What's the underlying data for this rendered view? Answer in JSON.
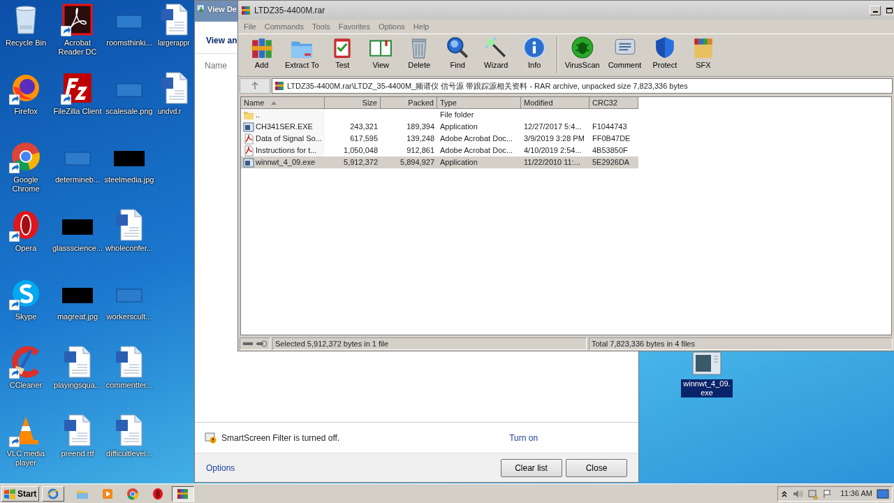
{
  "desktop": {
    "icons": [
      {
        "label": "Recycle Bin",
        "kind": "recycle-bin",
        "shortcut": false
      },
      {
        "label": "Firefox",
        "kind": "firefox",
        "shortcut": true
      },
      {
        "label": "Google Chrome",
        "kind": "chrome",
        "shortcut": true
      },
      {
        "label": "Opera",
        "kind": "opera",
        "shortcut": true
      },
      {
        "label": "Skype",
        "kind": "skype",
        "shortcut": true
      },
      {
        "label": "CCleaner",
        "kind": "ccleaner",
        "shortcut": true
      },
      {
        "label": "VLC media player",
        "kind": "vlc",
        "shortcut": true
      },
      {
        "label": "Acrobat Reader DC",
        "kind": "acrobat",
        "shortcut": true
      },
      {
        "label": "FileZilla Client",
        "kind": "filezilla",
        "shortcut": true
      },
      {
        "label": "determineb...",
        "kind": "blank",
        "shortcut": false
      },
      {
        "label": "glassscience...",
        "kind": "black",
        "shortcut": false
      },
      {
        "label": "magreat.jpg",
        "kind": "black",
        "shortcut": false
      },
      {
        "label": "playingsqua...",
        "kind": "word",
        "shortcut": false
      },
      {
        "label": "preend.rtf",
        "kind": "word",
        "shortcut": false
      },
      {
        "label": "roomsthinki...",
        "kind": "blank",
        "shortcut": false
      },
      {
        "label": "scalesale.png",
        "kind": "blank",
        "shortcut": false
      },
      {
        "label": "steelmedia.jpg",
        "kind": "black",
        "shortcut": false
      },
      {
        "label": "wholeconfer...",
        "kind": "word",
        "shortcut": false
      },
      {
        "label": "workerscult...",
        "kind": "blank",
        "shortcut": false
      },
      {
        "label": "commentter...",
        "kind": "word",
        "shortcut": false
      },
      {
        "label": "difficultlevel...",
        "kind": "word",
        "shortcut": false
      },
      {
        "label": "largerappr",
        "kind": "word",
        "shortcut": false
      },
      {
        "label": "undvd.r",
        "kind": "word",
        "shortcut": false
      }
    ]
  },
  "downloads_window": {
    "title": "View De",
    "heading": "View an",
    "column": "Name",
    "smartscreen": {
      "text": "SmartScreen Filter is turned off.",
      "link": "Turn on"
    },
    "options_link": "Options",
    "buttons": [
      "Clear list",
      "Close"
    ]
  },
  "winrar": {
    "title": "LTDZ35-4400M.rar",
    "menu": [
      "File",
      "Commands",
      "Tools",
      "Favorites",
      "Options",
      "Help"
    ],
    "toolbar_groups": [
      [
        {
          "label": "Add",
          "kind": "add"
        },
        {
          "label": "Extract To",
          "kind": "extract"
        },
        {
          "label": "Test",
          "kind": "test"
        },
        {
          "label": "View",
          "kind": "view"
        },
        {
          "label": "Delete",
          "kind": "delete"
        },
        {
          "label": "Find",
          "kind": "find"
        },
        {
          "label": "Wizard",
          "kind": "wizard"
        },
        {
          "label": "Info",
          "kind": "info"
        }
      ],
      [
        {
          "label": "VirusScan",
          "kind": "virus"
        },
        {
          "label": "Comment",
          "kind": "comment"
        },
        {
          "label": "Protect",
          "kind": "protect"
        },
        {
          "label": "SFX",
          "kind": "sfx"
        }
      ]
    ],
    "address": "LTDZ35-4400M.rar\\LTDZ_35-4400M_频谱仪 信号源 带跟踪源相关资料 - RAR archive, unpacked size 7,823,336 bytes",
    "columns": [
      {
        "label": "Name",
        "sorted": true
      },
      {
        "label": "Size",
        "sorted": false
      },
      {
        "label": "Packed",
        "sorted": false
      },
      {
        "label": "Type",
        "sorted": false
      },
      {
        "label": "Modified",
        "sorted": false
      },
      {
        "label": "CRC32",
        "sorted": false
      }
    ],
    "rows": [
      {
        "kind": "folder",
        "selected": false,
        "cells": [
          "..",
          "",
          "",
          "File folder",
          "",
          ""
        ]
      },
      {
        "kind": "exe",
        "selected": false,
        "cells": [
          "CH341SER.EXE",
          "243,321",
          "189,394",
          "Application",
          "12/27/2017 5:4...",
          "F1044743"
        ]
      },
      {
        "kind": "pdf",
        "selected": false,
        "cells": [
          "Data of Signal So...",
          "617,595",
          "139,248",
          "Adobe Acrobat Doc...",
          "3/9/2019 3:28 PM",
          "FF0B47DE"
        ]
      },
      {
        "kind": "pdf",
        "selected": false,
        "cells": [
          "Instructions for t...",
          "1,050,048",
          "912,861",
          "Adobe Acrobat Doc...",
          "4/10/2019 2:54...",
          "4B53850F"
        ]
      },
      {
        "kind": "exe",
        "selected": true,
        "cells": [
          "winnwt_4_09.exe",
          "5,912,372",
          "5,894,927",
          "Application",
          "11/22/2010 11:...",
          "5E2926DA"
        ]
      }
    ],
    "status": {
      "selected": "Selected 5,912,372 bytes in 1 file",
      "total": "Total 7,823,336 bytes in 4 files"
    }
  },
  "desktop_file": {
    "label": "winnwt_4_09.exe",
    "selected": true
  },
  "taskbar": {
    "start": "Start",
    "apps": [
      {
        "kind": "ie",
        "active": false
      },
      {
        "kind": "explorer",
        "active": false
      },
      {
        "kind": "media",
        "active": false
      },
      {
        "kind": "chrome",
        "active": false
      },
      {
        "kind": "opera",
        "active": false
      },
      {
        "kind": "winrar",
        "active": true
      }
    ],
    "clock": "11:36 AM"
  }
}
